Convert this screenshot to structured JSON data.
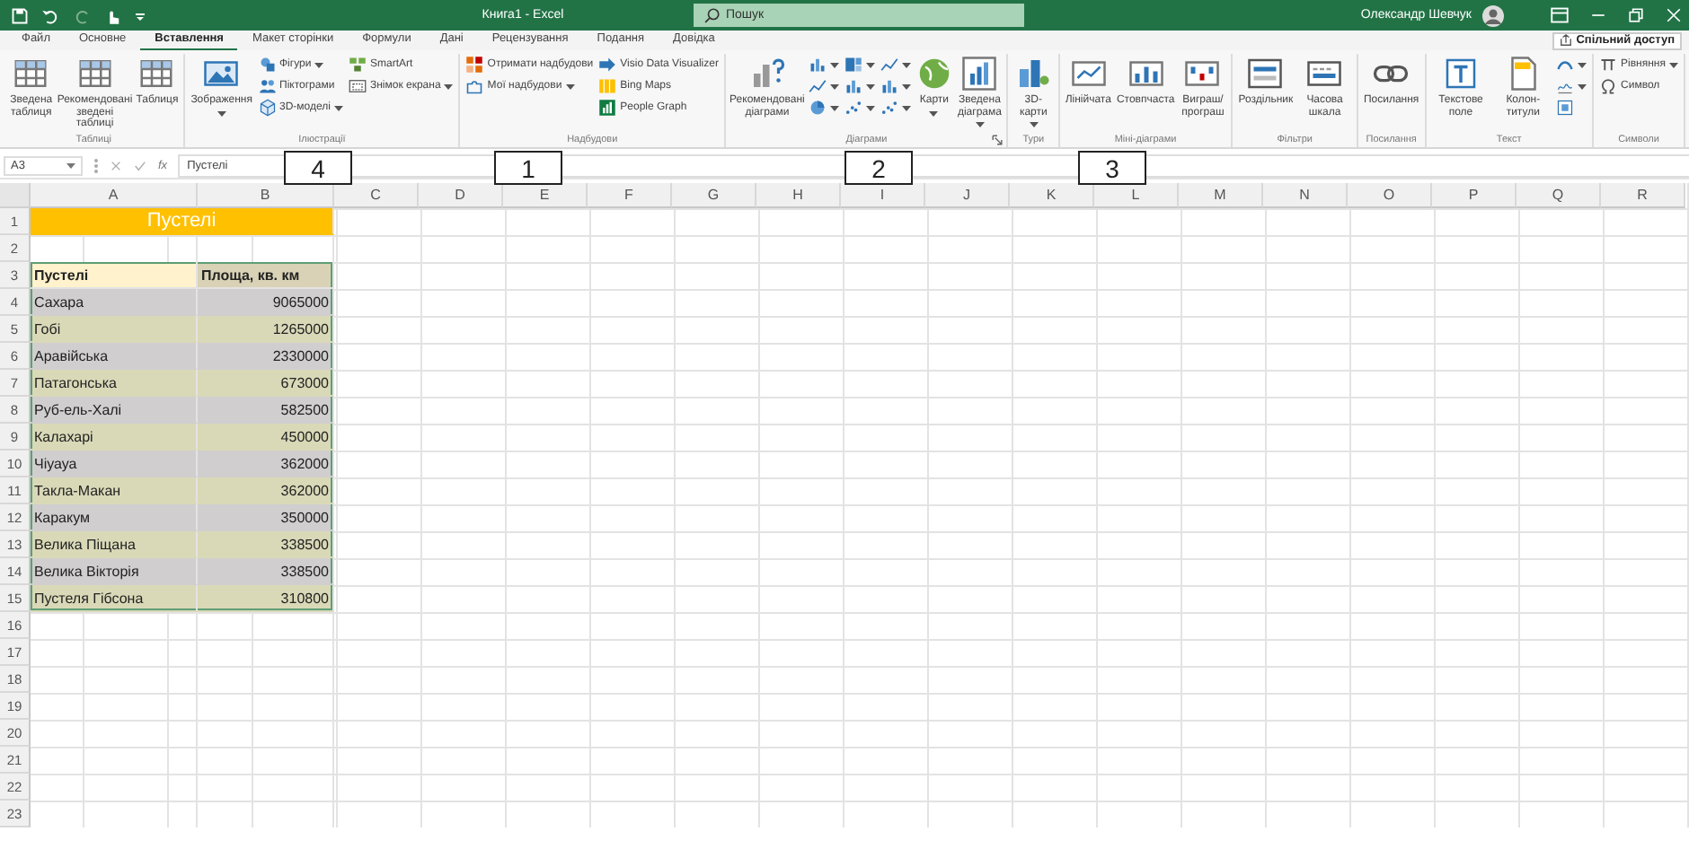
{
  "title_bar": {
    "title": "Книга1 - Excel",
    "search": {
      "placeholder": "Пошук"
    },
    "user": "Олександр Шевчук"
  },
  "tabs": [
    {
      "label": "Файл",
      "selected": false
    },
    {
      "label": "Основне",
      "selected": false
    },
    {
      "label": "Вставлення",
      "selected": true
    },
    {
      "label": "Макет сторінки",
      "selected": false
    },
    {
      "label": "Формули",
      "selected": false
    },
    {
      "label": "Дані",
      "selected": false
    },
    {
      "label": "Рецензування",
      "selected": false
    },
    {
      "label": "Подання",
      "selected": false
    },
    {
      "label": "Довідка",
      "selected": false
    }
  ],
  "share_button": "Спільний доступ",
  "ribbon": [
    {
      "label": "Таблиці",
      "cols": [
        {
          "kind": "large",
          "label": "Зведена таблиця"
        },
        {
          "kind": "large",
          "label": "Рекомендовані зведені таблиці"
        },
        {
          "kind": "large",
          "label": "Таблиця"
        }
      ]
    },
    {
      "label": "Ілюстрації",
      "cols": [
        {
          "kind": "large",
          "label": "Зображення",
          "menu": true
        },
        {
          "kind": "stack",
          "items": [
            {
              "label": "Фігури",
              "menu": true
            },
            {
              "label": "Піктограми"
            },
            {
              "label": "3D-моделі",
              "menu": true
            }
          ]
        },
        {
          "kind": "stack",
          "items": [
            {
              "label": "SmartArt"
            },
            {
              "label": "Знімок екрана",
              "menu": true
            }
          ]
        }
      ]
    },
    {
      "label": "Надбудови",
      "cols": [
        {
          "kind": "stack",
          "items": [
            {
              "label": "Отримати надбудови"
            },
            {
              "label": "Мої надбудови",
              "menu": true
            }
          ]
        },
        {
          "kind": "stack",
          "items": [
            {
              "label": "Visio Data Visualizer"
            },
            {
              "label": "Bing Maps"
            },
            {
              "label": "People Graph"
            }
          ]
        }
      ]
    },
    {
      "label": "Діаграми",
      "launcher": true,
      "cols": [
        {
          "kind": "large",
          "label": "Рекомендовані діаграми"
        },
        {
          "kind": "stack",
          "items": [
            {
              "menu": true
            },
            {
              "menu": true
            },
            {
              "menu": true
            }
          ]
        },
        {
          "kind": "stack",
          "items": [
            {
              "menu": true
            },
            {
              "menu": true
            },
            {
              "menu": true
            }
          ]
        },
        {
          "kind": "stack",
          "items": [
            {
              "menu": true
            },
            {
              "menu": true
            },
            {
              "menu": true
            }
          ]
        },
        {
          "kind": "large",
          "label": "Карти",
          "menu": true
        },
        {
          "kind": "large",
          "label": "Зведена діаграма",
          "menu": true
        }
      ]
    },
    {
      "label": "Тури",
      "cols": [
        {
          "kind": "large",
          "label": "3D-карти",
          "menu": true
        }
      ]
    },
    {
      "label": "Міні-діаграми",
      "cols": [
        {
          "kind": "large",
          "label": "Лінійчата"
        },
        {
          "kind": "large",
          "label": "Стовпчаста"
        },
        {
          "kind": "large",
          "label": "Виграш/ програш"
        }
      ]
    },
    {
      "label": "Фільтри",
      "cols": [
        {
          "kind": "large",
          "label": "Роздільник"
        },
        {
          "kind": "large",
          "label": "Часова шкала"
        }
      ]
    },
    {
      "label": "Посилання",
      "cols": [
        {
          "kind": "large",
          "label": "Посилання"
        }
      ]
    },
    {
      "label": "Текст",
      "cols": [
        {
          "kind": "large",
          "label": "Текстове поле"
        },
        {
          "kind": "large",
          "label": "Колон-титули"
        },
        {
          "kind": "stack",
          "items": [
            {
              "menu": true
            },
            {
              "menu": true
            },
            {
              "menu": false
            }
          ]
        }
      ]
    },
    {
      "label": "Символи",
      "cols": [
        {
          "kind": "stack",
          "items": [
            {
              "label": "Рівняння",
              "menu": true
            },
            {
              "label": "Символ"
            }
          ]
        }
      ]
    }
  ],
  "formula_bar": {
    "name_box": "A3",
    "function_label": "fx",
    "value": "Пустелі"
  },
  "callouts": [
    "4",
    "1",
    "2",
    "3"
  ],
  "sheet": {
    "columns": [
      "A",
      "B",
      "C",
      "D",
      "E",
      "F",
      "G",
      "H",
      "I",
      "J",
      "K",
      "L",
      "M",
      "N",
      "O",
      "P",
      "Q",
      "R"
    ],
    "rows": [
      "1",
      "2",
      "3",
      "4",
      "5",
      "6",
      "7",
      "8",
      "9",
      "10",
      "11",
      "12",
      "13",
      "14",
      "15",
      "16",
      "17",
      "18",
      "19",
      "20",
      "21",
      "22",
      "23"
    ],
    "title": "Пустелі",
    "header": [
      "Пустелі",
      "Площа, кв. км"
    ],
    "data": [
      {
        "name": "Сахара",
        "area": "9065000"
      },
      {
        "name": "Гобі",
        "area": "1265000"
      },
      {
        "name": "Аравійська",
        "area": "2330000"
      },
      {
        "name": "Патагонська",
        "area": "673000"
      },
      {
        "name": "Руб-ель-Халі",
        "area": "582500"
      },
      {
        "name": "Калахарі",
        "area": "450000"
      },
      {
        "name": "Чіуауа",
        "area": "362000"
      },
      {
        "name": "Такла-Макан",
        "area": "362000"
      },
      {
        "name": "Каракум",
        "area": "350000"
      },
      {
        "name": "Велика Піщана",
        "area": "338500"
      },
      {
        "name": "Велика Вікторія",
        "area": "338500"
      },
      {
        "name": "Пустеля Гібсона",
        "area": "310800"
      }
    ]
  }
}
